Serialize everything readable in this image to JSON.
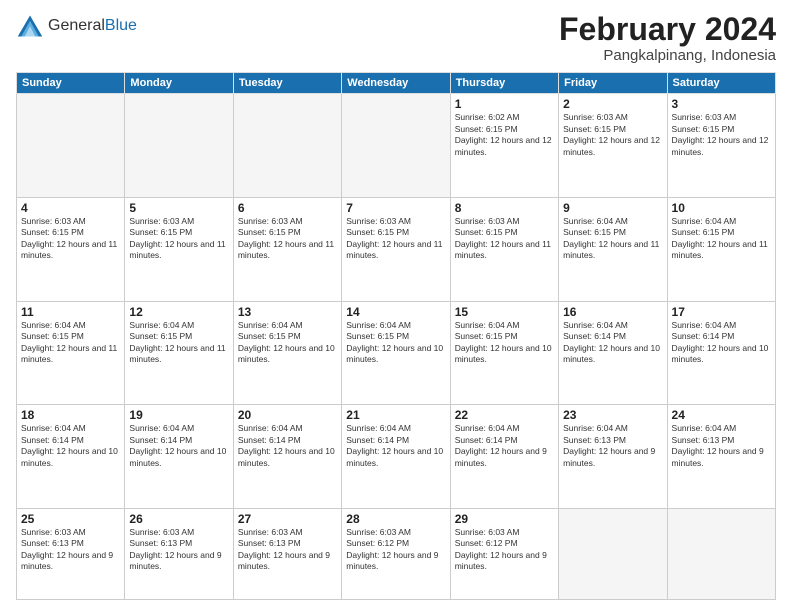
{
  "logo": {
    "general": "General",
    "blue": "Blue"
  },
  "title": {
    "month_year": "February 2024",
    "location": "Pangkalpinang, Indonesia"
  },
  "weekdays": [
    "Sunday",
    "Monday",
    "Tuesday",
    "Wednesday",
    "Thursday",
    "Friday",
    "Saturday"
  ],
  "weeks": [
    [
      {
        "day": "",
        "empty": true
      },
      {
        "day": "",
        "empty": true
      },
      {
        "day": "",
        "empty": true
      },
      {
        "day": "",
        "empty": true
      },
      {
        "day": "1",
        "sunrise": "6:02 AM",
        "sunset": "6:15 PM",
        "daylight": "12 hours and 12 minutes."
      },
      {
        "day": "2",
        "sunrise": "6:03 AM",
        "sunset": "6:15 PM",
        "daylight": "12 hours and 12 minutes."
      },
      {
        "day": "3",
        "sunrise": "6:03 AM",
        "sunset": "6:15 PM",
        "daylight": "12 hours and 12 minutes."
      }
    ],
    [
      {
        "day": "4",
        "sunrise": "6:03 AM",
        "sunset": "6:15 PM",
        "daylight": "12 hours and 11 minutes."
      },
      {
        "day": "5",
        "sunrise": "6:03 AM",
        "sunset": "6:15 PM",
        "daylight": "12 hours and 11 minutes."
      },
      {
        "day": "6",
        "sunrise": "6:03 AM",
        "sunset": "6:15 PM",
        "daylight": "12 hours and 11 minutes."
      },
      {
        "day": "7",
        "sunrise": "6:03 AM",
        "sunset": "6:15 PM",
        "daylight": "12 hours and 11 minutes."
      },
      {
        "day": "8",
        "sunrise": "6:03 AM",
        "sunset": "6:15 PM",
        "daylight": "12 hours and 11 minutes."
      },
      {
        "day": "9",
        "sunrise": "6:04 AM",
        "sunset": "6:15 PM",
        "daylight": "12 hours and 11 minutes."
      },
      {
        "day": "10",
        "sunrise": "6:04 AM",
        "sunset": "6:15 PM",
        "daylight": "12 hours and 11 minutes."
      }
    ],
    [
      {
        "day": "11",
        "sunrise": "6:04 AM",
        "sunset": "6:15 PM",
        "daylight": "12 hours and 11 minutes."
      },
      {
        "day": "12",
        "sunrise": "6:04 AM",
        "sunset": "6:15 PM",
        "daylight": "12 hours and 11 minutes."
      },
      {
        "day": "13",
        "sunrise": "6:04 AM",
        "sunset": "6:15 PM",
        "daylight": "12 hours and 10 minutes."
      },
      {
        "day": "14",
        "sunrise": "6:04 AM",
        "sunset": "6:15 PM",
        "daylight": "12 hours and 10 minutes."
      },
      {
        "day": "15",
        "sunrise": "6:04 AM",
        "sunset": "6:15 PM",
        "daylight": "12 hours and 10 minutes."
      },
      {
        "day": "16",
        "sunrise": "6:04 AM",
        "sunset": "6:14 PM",
        "daylight": "12 hours and 10 minutes."
      },
      {
        "day": "17",
        "sunrise": "6:04 AM",
        "sunset": "6:14 PM",
        "daylight": "12 hours and 10 minutes."
      }
    ],
    [
      {
        "day": "18",
        "sunrise": "6:04 AM",
        "sunset": "6:14 PM",
        "daylight": "12 hours and 10 minutes."
      },
      {
        "day": "19",
        "sunrise": "6:04 AM",
        "sunset": "6:14 PM",
        "daylight": "12 hours and 10 minutes."
      },
      {
        "day": "20",
        "sunrise": "6:04 AM",
        "sunset": "6:14 PM",
        "daylight": "12 hours and 10 minutes."
      },
      {
        "day": "21",
        "sunrise": "6:04 AM",
        "sunset": "6:14 PM",
        "daylight": "12 hours and 10 minutes."
      },
      {
        "day": "22",
        "sunrise": "6:04 AM",
        "sunset": "6:14 PM",
        "daylight": "12 hours and 9 minutes."
      },
      {
        "day": "23",
        "sunrise": "6:04 AM",
        "sunset": "6:13 PM",
        "daylight": "12 hours and 9 minutes."
      },
      {
        "day": "24",
        "sunrise": "6:04 AM",
        "sunset": "6:13 PM",
        "daylight": "12 hours and 9 minutes."
      }
    ],
    [
      {
        "day": "25",
        "sunrise": "6:03 AM",
        "sunset": "6:13 PM",
        "daylight": "12 hours and 9 minutes."
      },
      {
        "day": "26",
        "sunrise": "6:03 AM",
        "sunset": "6:13 PM",
        "daylight": "12 hours and 9 minutes."
      },
      {
        "day": "27",
        "sunrise": "6:03 AM",
        "sunset": "6:13 PM",
        "daylight": "12 hours and 9 minutes."
      },
      {
        "day": "28",
        "sunrise": "6:03 AM",
        "sunset": "6:12 PM",
        "daylight": "12 hours and 9 minutes."
      },
      {
        "day": "29",
        "sunrise": "6:03 AM",
        "sunset": "6:12 PM",
        "daylight": "12 hours and 9 minutes."
      },
      {
        "day": "",
        "empty": true
      },
      {
        "day": "",
        "empty": true
      }
    ]
  ],
  "labels": {
    "sunrise_prefix": "Sunrise: ",
    "sunset_prefix": "Sunset: ",
    "daylight_prefix": "Daylight: "
  }
}
